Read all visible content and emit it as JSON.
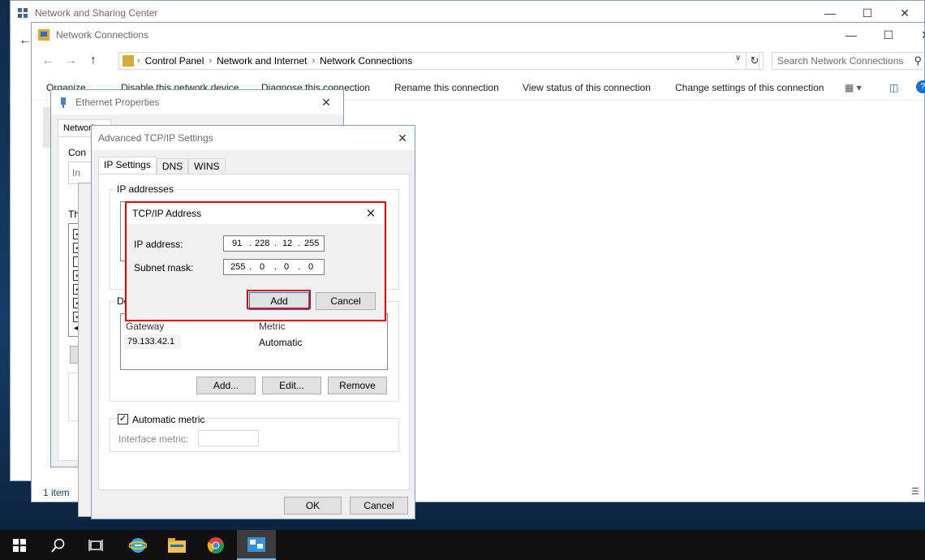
{
  "nsc_window": {
    "title": "Network and Sharing Center"
  },
  "nc_window": {
    "title": "Network Connections",
    "breadcrumbs": [
      "Control Panel",
      "Network and Internet",
      "Network Connections"
    ],
    "search_placeholder": "Search Network Connections",
    "commands": {
      "organize": "Organize",
      "disable": "Disable this network device",
      "diagnose": "Diagnose this connection",
      "rename": "Rename this connection",
      "view_status": "View status of this connection",
      "change_settings": "Change settings of this connection"
    },
    "status": "1 item"
  },
  "eth_window": {
    "title": "Ethernet Properties",
    "tab_label": "Network",
    "fragments": {
      "connect": "Con",
      "this_conn": "Th",
      "desc": "D",
      "ins": "In"
    }
  },
  "adv_window": {
    "title": "Advanced TCP/IP Settings",
    "tabs": [
      "IP Settings",
      "DNS",
      "WINS"
    ],
    "ip_group_label": "IP addresses",
    "gateway_group_label": "De",
    "gateway_columns": [
      "Gateway",
      "Metric"
    ],
    "gateway_rows": [
      {
        "gateway": "79.133.42.1",
        "metric": "Automatic"
      }
    ],
    "buttons": {
      "add": "Add...",
      "edit": "Edit...",
      "remove": "Remove",
      "ok": "OK",
      "cancel": "Cancel"
    },
    "automatic_metric_label": "Automatic metric",
    "interface_metric_label": "Interface metric:"
  },
  "tcpip_dialog": {
    "title": "TCP/IP Address",
    "ip_label": "IP address:",
    "ip_octets": [
      "91",
      "228",
      "12",
      "255"
    ],
    "mask_label": "Subnet mask:",
    "mask_octets": [
      "255",
      "0",
      "0",
      "0"
    ],
    "add_label": "Add",
    "cancel_label": "Cancel"
  },
  "colors": {
    "highlight": "#e00000",
    "taskbar": "#101010",
    "accent": "#0078d7"
  }
}
